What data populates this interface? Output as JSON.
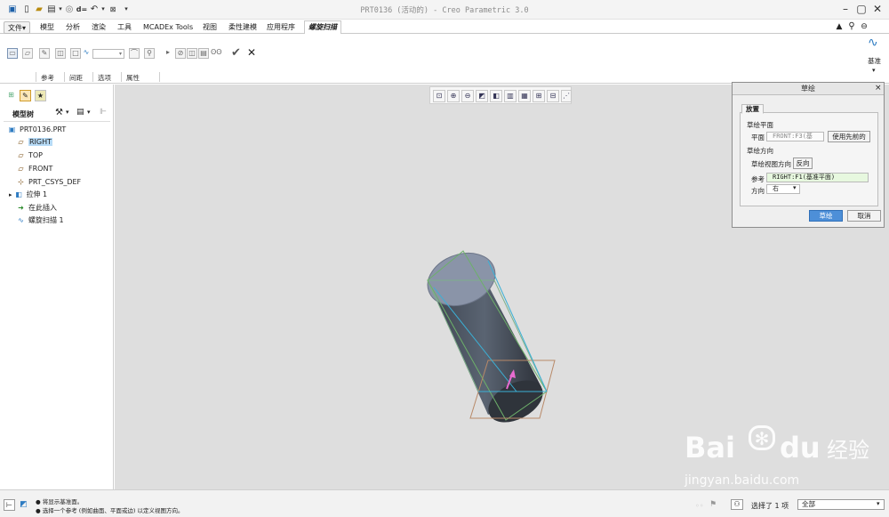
{
  "window": {
    "title": "PRT0136 (活动的) - Creo Parametric 3.0"
  },
  "quick_access": [
    "save-icon",
    "new-icon",
    "open-icon",
    "dropdown-icon",
    "regenerate-icon",
    "dx-icon",
    "undo-icon",
    "dropdown-icon",
    "close-window-icon",
    "customize-icon"
  ],
  "quick_access_text": {
    "dx": "d="
  },
  "menubar": {
    "tabs": [
      {
        "label": "文件▾"
      },
      {
        "label": "模型"
      },
      {
        "label": "分析"
      },
      {
        "label": "渲染"
      },
      {
        "label": "工具"
      },
      {
        "label": "MCADEx Tools"
      },
      {
        "label": "视图"
      },
      {
        "label": "柔性建模"
      },
      {
        "label": "应用程序"
      },
      {
        "label": "螺旋扫描"
      }
    ],
    "right_icons": [
      "view-toggle-icon",
      "search-icon",
      "help-icon"
    ]
  },
  "ribbon": {
    "tabs": [
      {
        "label": "参考"
      },
      {
        "label": "间距"
      },
      {
        "label": "选项"
      },
      {
        "label": "属性"
      }
    ],
    "right_label": "基准"
  },
  "left_panel": {
    "header": "模型树",
    "items": [
      {
        "label": "PRT0136.PRT",
        "icon": "part-icon"
      },
      {
        "label": "RIGHT",
        "icon": "datum-plane-icon",
        "selected": true
      },
      {
        "label": "TOP",
        "icon": "datum-plane-icon"
      },
      {
        "label": "FRONT",
        "icon": "datum-plane-icon"
      },
      {
        "label": "PRT_CSYS_DEF",
        "icon": "csys-icon"
      },
      {
        "label": "拉伸 1",
        "icon": "extrude-icon"
      },
      {
        "label": "在此插入",
        "icon": "insert-arrow-icon"
      },
      {
        "label": "螺旋扫描 1",
        "icon": "helical-sweep-icon"
      }
    ]
  },
  "dialog": {
    "title": "草绘",
    "close": "×",
    "tab": "放置",
    "section_plane": "草绘平面",
    "plane_label": "平面",
    "plane_value": "FRONT:F3(基",
    "use_previous": "使用先前的",
    "section_orient": "草绘方向",
    "view_dir_label": "草绘视图方向",
    "flip": "反向",
    "ref_label": "参考",
    "ref_value": "RIGHT:F1(基准平面)",
    "dir_label": "方向",
    "dir_value": "右",
    "ok": "草绘",
    "cancel": "取消"
  },
  "status": {
    "line1": "● 将显示基准面。",
    "line2": "● 选择一个参考 (例如曲面、平面或边) 以定义视图方向。",
    "selection": "选择了 1 项",
    "filter": "全部"
  },
  "watermark": {
    "brand": "Bai",
    "brand2": "du",
    "cn": "经验",
    "url": "jingyan.baidu.com"
  },
  "colors": {
    "accent": "#2f7cc2",
    "selected": "#b7dbf7",
    "field_green": "#e7f8df"
  }
}
